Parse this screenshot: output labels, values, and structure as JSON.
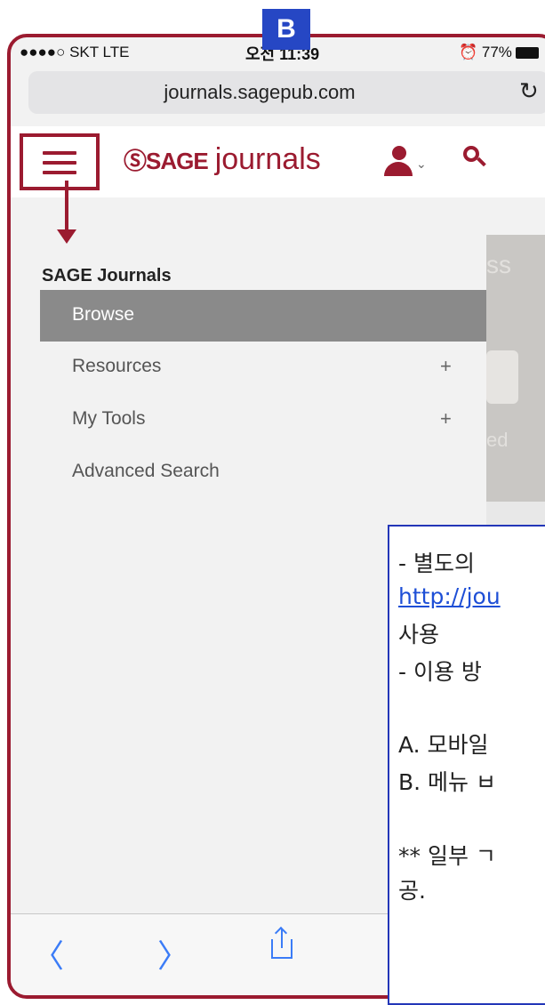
{
  "badge": "B",
  "status_bar": {
    "carrier": "●●●●○ SKT  LTE",
    "time": "오전 11:39",
    "battery": "⏰ 77%"
  },
  "browser": {
    "url": "journals.sagepub.com",
    "reload_icon": "reload-icon"
  },
  "header": {
    "logo_brand": "ⓈSAGE",
    "logo_suffix": "journals"
  },
  "drawer": {
    "title": "SAGE Journals",
    "items": [
      {
        "label": "Browse",
        "expand": "",
        "active": true
      },
      {
        "label": "Resources",
        "expand": "+",
        "active": false
      },
      {
        "label": "My Tools",
        "expand": "+",
        "active": false
      },
      {
        "label": "Advanced Search",
        "expand": "",
        "active": false
      }
    ]
  },
  "background_page": {
    "text_top": "ss",
    "text_bottom": "ed"
  },
  "annotation": {
    "line1": "- 별도의",
    "link": "http://jou",
    "line3": "사용",
    "line4": "- 이용 방",
    "line5": "A. 모바일",
    "line6": "B. 메뉴 ㅂ",
    "line7": "** 일부 ㄱ",
    "line8": "공."
  },
  "toolbar": {
    "back": "〈",
    "forward": "〉"
  },
  "colors": {
    "accent": "#9b1b30",
    "ios_blue": "#3b7cf7",
    "badge_blue": "#2647c4"
  }
}
